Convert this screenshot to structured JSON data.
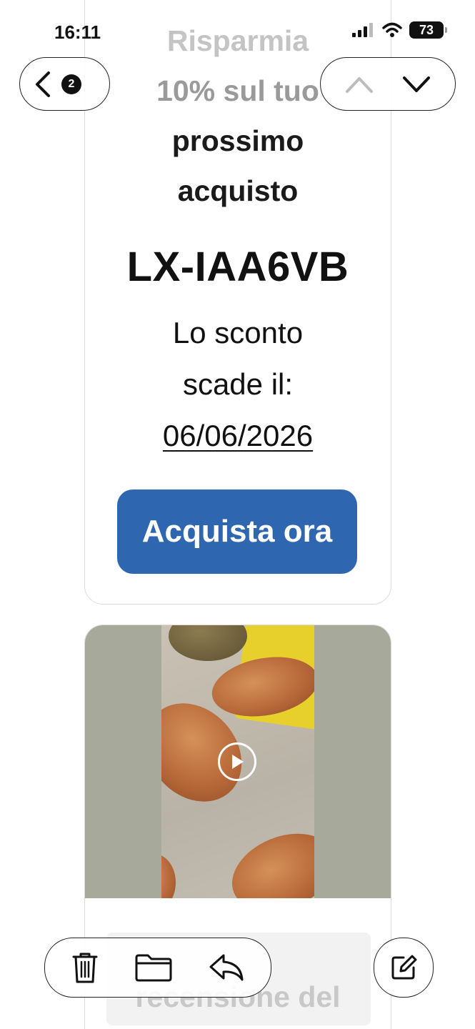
{
  "status_bar": {
    "time": "16:11",
    "battery": "73"
  },
  "nav": {
    "back_count": "2"
  },
  "email": {
    "headline_lines": [
      "Risparmia",
      "10% sul tuo",
      "prossimo",
      "acquisto"
    ],
    "code": "LX-IAA6VB",
    "expiry_line1": "Lo sconto",
    "expiry_line2": "scade il:",
    "expiry_date": "06/06/2026",
    "cta_label": "Acquista ora",
    "review_fragment": "recensione del"
  },
  "icons": {
    "back": "chevron-left-icon",
    "prev": "chevron-up-icon",
    "next": "chevron-down-icon",
    "trash": "trash-icon",
    "folder": "folder-icon",
    "reply": "reply-icon",
    "compose": "compose-icon",
    "play": "play-icon"
  },
  "colors": {
    "cta": "#2f66b0",
    "video_bg": "#a7a99b"
  }
}
